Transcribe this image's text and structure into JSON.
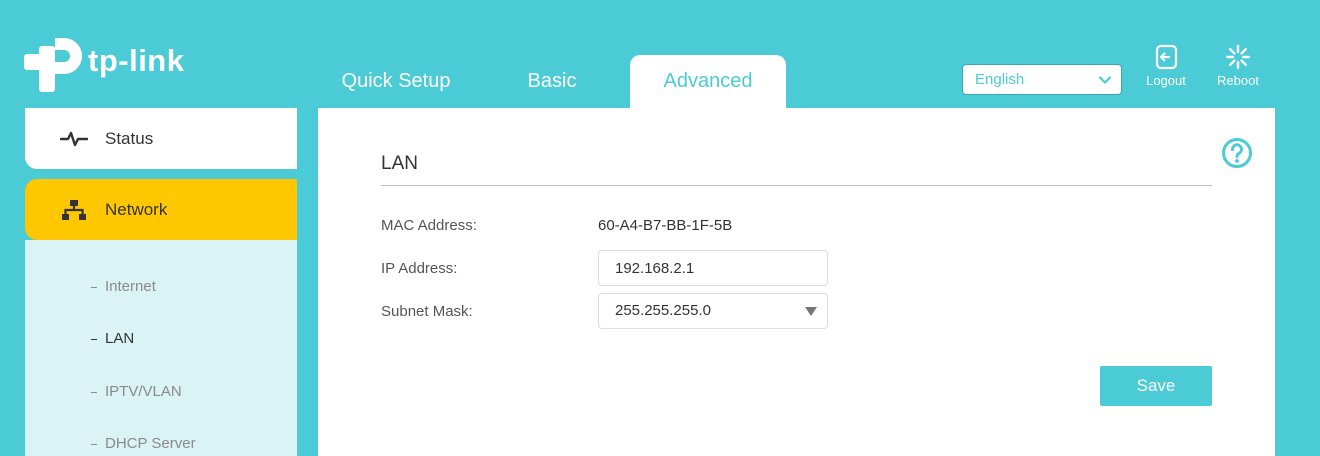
{
  "brand": {
    "name": "tp-link",
    "accent": "#4acbd6",
    "highlight": "#ffc700"
  },
  "tabs": [
    {
      "label": "Quick Setup"
    },
    {
      "label": "Basic"
    },
    {
      "label": "Advanced",
      "active": true
    }
  ],
  "language": {
    "selected": "English"
  },
  "top_buttons": {
    "logout": "Logout",
    "reboot": "Reboot"
  },
  "sidebar": {
    "status": {
      "label": "Status",
      "icon": "pulse-icon"
    },
    "network": {
      "label": "Network",
      "icon": "network-topology-icon",
      "active": true
    },
    "sub_items": [
      {
        "label": "Internet"
      },
      {
        "label": "LAN",
        "active": true
      },
      {
        "label": "IPTV/VLAN"
      },
      {
        "label": "DHCP Server"
      }
    ]
  },
  "lan": {
    "title": "LAN",
    "mac_label": "MAC Address:",
    "mac_value": "60-A4-B7-BB-1F-5B",
    "ip_label": "IP Address:",
    "ip_value": "192.168.2.1",
    "subnet_label": "Subnet Mask:",
    "subnet_value": "255.255.255.0",
    "save_label": "Save"
  }
}
